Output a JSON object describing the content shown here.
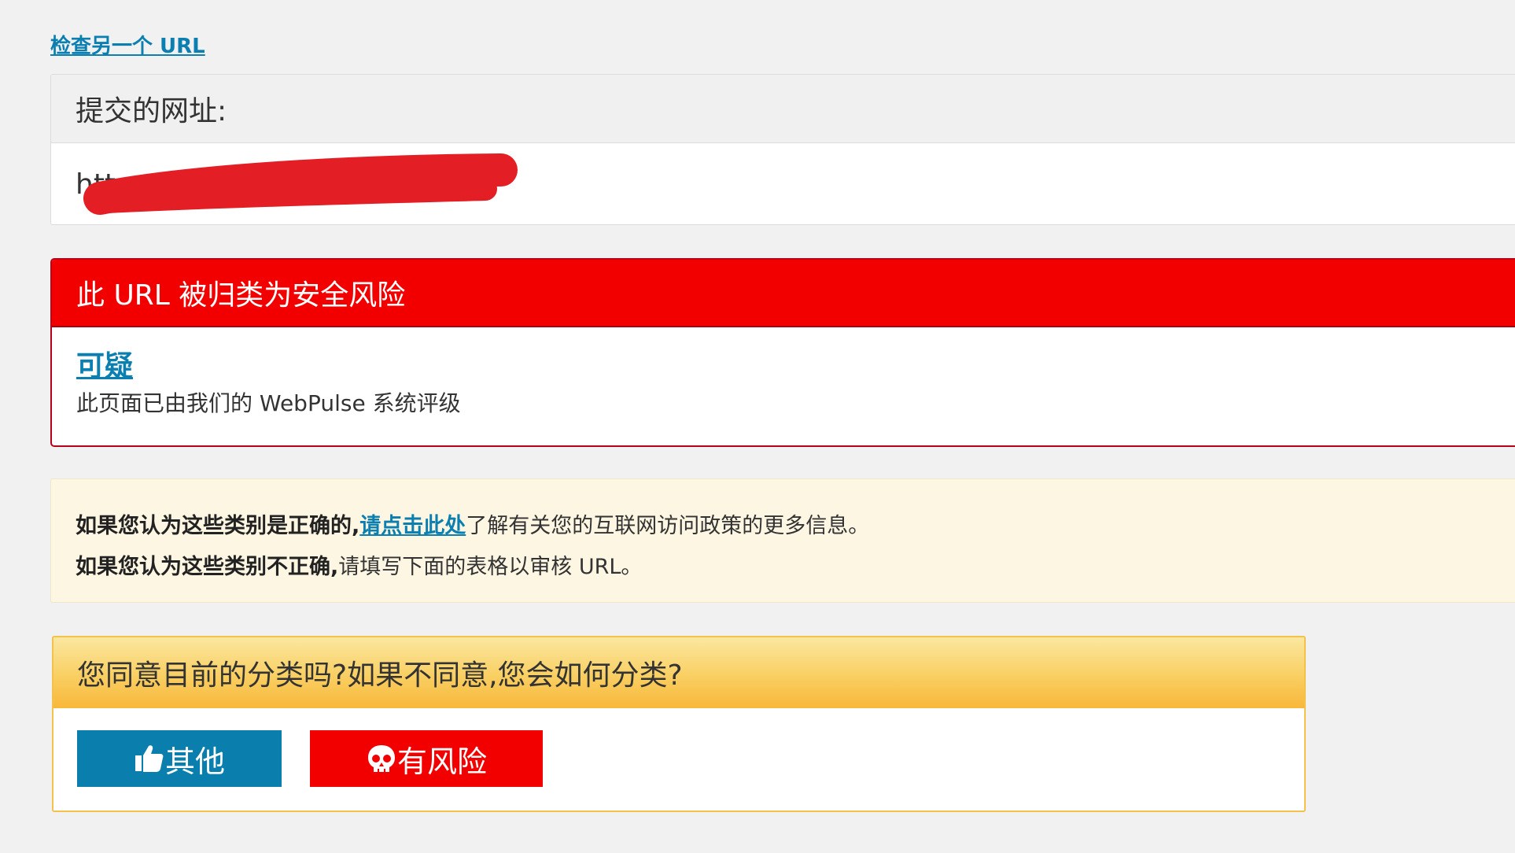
{
  "top_link": "检查另一个 URL",
  "submitted": {
    "title": "提交的网址:",
    "url_value": "https://www.example.com/"
  },
  "risk": {
    "title": "此 URL 被归类为安全风险",
    "category": "可疑",
    "description": "此页面已由我们的 WebPulse 系统评级"
  },
  "info": {
    "line1_bold": "如果您认为这些类别是正确的,",
    "line1_link": "请点击此处",
    "line1_rest": "了解有关您的互联网访问政策的更多信息。",
    "line2_bold": "如果您认为这些类别不正确,",
    "line2_rest": "请填写下面的表格以审核 URL。"
  },
  "agree": {
    "question": "您同意目前的分类吗?如果不同意,您会如何分类?",
    "buttons": {
      "other": {
        "label": "其他",
        "icon": "thumbs-up-icon"
      },
      "risk": {
        "label": "有风险",
        "icon": "skull-icon"
      }
    }
  },
  "colors": {
    "link": "#0b7fb0",
    "danger": "#f20000",
    "primary_button": "#0a7fae",
    "warning_header": "#f9cf62",
    "info_background": "#fcf6e2",
    "redaction": "#e31e24"
  }
}
